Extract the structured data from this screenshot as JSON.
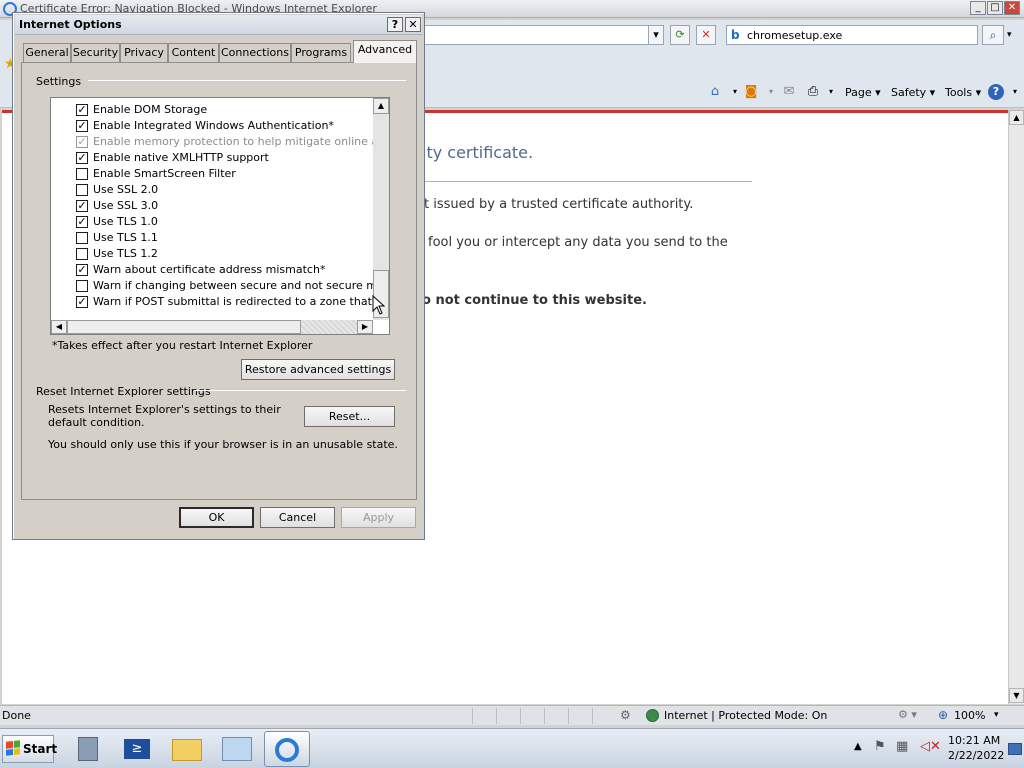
{
  "ie": {
    "title": "Certificate Error: Navigation Blocked - Windows Internet Explorer",
    "search_text": "chromesetup.exe",
    "commands": {
      "page": "Page",
      "safety": "Safety",
      "tools": "Tools"
    },
    "content": {
      "heading": "ity certificate.",
      "line1": "t issued by a trusted certificate authority.",
      "line2": "fool you or intercept any data you send to the",
      "line3": "o not continue to this website."
    },
    "status": {
      "text": "Done",
      "zone": "Internet | Protected Mode: On",
      "zoom": "100%"
    }
  },
  "taskbar": {
    "start_label": "Start",
    "time": "10:21 AM",
    "date": "2/22/2022"
  },
  "dialog": {
    "title": "Internet Options",
    "help": "?",
    "close": "✕",
    "tabs": [
      "General",
      "Security",
      "Privacy",
      "Content",
      "Connections",
      "Programs",
      "Advanced"
    ],
    "active_tab": "Advanced",
    "settings_label": "Settings",
    "settings": [
      {
        "label": "Enable DOM Storage",
        "checked": true,
        "disabled": false
      },
      {
        "label": "Enable Integrated Windows Authentication*",
        "checked": true,
        "disabled": false
      },
      {
        "label": "Enable memory protection to help mitigate online attacks*",
        "checked": true,
        "disabled": true
      },
      {
        "label": "Enable native XMLHTTP support",
        "checked": true,
        "disabled": false
      },
      {
        "label": "Enable SmartScreen Filter",
        "checked": false,
        "disabled": false
      },
      {
        "label": "Use SSL 2.0",
        "checked": false,
        "disabled": false
      },
      {
        "label": "Use SSL 3.0",
        "checked": true,
        "disabled": false
      },
      {
        "label": "Use TLS 1.0",
        "checked": true,
        "disabled": false
      },
      {
        "label": "Use TLS 1.1",
        "checked": false,
        "disabled": false
      },
      {
        "label": "Use TLS 1.2",
        "checked": false,
        "disabled": false
      },
      {
        "label": "Warn about certificate address mismatch*",
        "checked": true,
        "disabled": false
      },
      {
        "label": "Warn if changing between secure and not secure mode",
        "checked": false,
        "disabled": false
      },
      {
        "label": "Warn if POST submittal is redirected to a zone that does n",
        "checked": true,
        "disabled": false
      }
    ],
    "restart_note": "*Takes effect after you restart Internet Explorer",
    "restore_button": "Restore advanced settings",
    "reset_group_label": "Reset Internet Explorer settings",
    "reset_desc": "Resets Internet Explorer's settings to their default condition.",
    "reset_button": "Reset...",
    "reset_warning": "You should only use this if your browser is in an unusable state.",
    "ok_button": "OK",
    "cancel_button": "Cancel",
    "apply_button": "Apply"
  },
  "colors": {
    "content_heading": "#4f6a8f",
    "cert_error_bar": "#c6362c",
    "dialog_face": "#d4d0c8"
  }
}
